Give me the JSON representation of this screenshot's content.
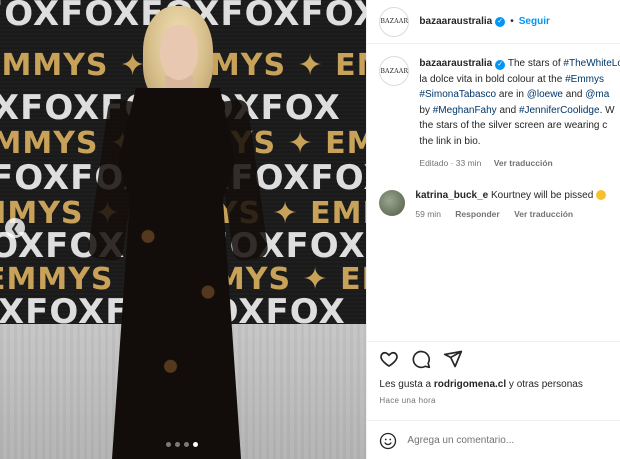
{
  "account": {
    "username": "bazaaraustralia",
    "avatar_text": "BAZAAR",
    "follow_label": "Seguir",
    "separator": "•"
  },
  "backdrop": {
    "fox_text": "FOXFOXFOXFOXFOX",
    "emmys_text": "EMMYS ✦ EMMYS ✦ EMMYS"
  },
  "caption": {
    "username": "bazaaraustralia",
    "lines": [
      [
        {
          "text": "The stars of "
        },
        {
          "text": "#TheWhiteLotus",
          "tag": true
        }
      ],
      [
        {
          "text": "la dolce vita in bold colour at the "
        },
        {
          "text": "#Emmys",
          "tag": true
        }
      ],
      [
        {
          "text": "#SimonaTabasco",
          "tag": true
        },
        {
          "text": " are in "
        },
        {
          "text": "@loewe",
          "tag": true
        },
        {
          "text": " and "
        },
        {
          "text": "@ma",
          "tag": true
        }
      ],
      [
        {
          "text": "by "
        },
        {
          "text": "#MeghanFahy",
          "tag": true
        },
        {
          "text": " and "
        },
        {
          "text": "#JenniferCoolidge",
          "tag": true
        },
        {
          "text": ". W"
        }
      ],
      [
        {
          "text": "the stars of the silver screen are wearing c"
        }
      ],
      [
        {
          "text": "the link in bio."
        }
      ]
    ],
    "edited": "Editado · 33 min",
    "translate": "Ver traducción"
  },
  "comment": {
    "username": "katrina_buck_e",
    "text": "Kourtney will be pissed",
    "time": "59 min",
    "reply": "Responder",
    "translate": "Ver traducción"
  },
  "actions": {
    "icons": [
      "heart-icon",
      "comment-icon",
      "share-icon"
    ],
    "likes_prefix": "Les gusta a ",
    "likes_user": "rodrigomena.cl",
    "likes_suffix": " y otras personas",
    "timestamp": "Hace una hora"
  },
  "add_comment": {
    "placeholder": "Agrega un comentario..."
  },
  "carousel": {
    "dot_count": 4,
    "active_index": 3
  },
  "colors": {
    "link": "#00376b",
    "accent": "#0095f6"
  }
}
